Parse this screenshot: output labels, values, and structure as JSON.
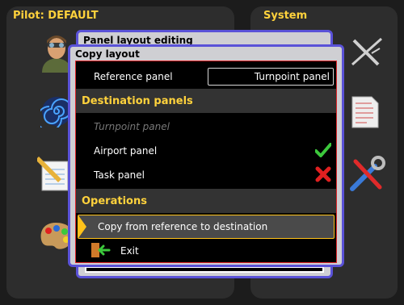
{
  "background": {
    "left_panel_title": "Pilot: DEFAULT",
    "right_panel_title": "System",
    "left_icons": [
      "pilot-avatar-icon",
      "spiral-icon",
      "notepad-icon",
      "palette-icon"
    ],
    "right_icons": [
      "airplane-icon",
      "document-list-icon",
      "tools-icon"
    ]
  },
  "back_dialog": {
    "title": "Panel layout editing"
  },
  "dialog": {
    "title": "Copy layout",
    "reference": {
      "label": "Reference panel",
      "value": "Turnpoint panel"
    },
    "destination_header": "Destination panels",
    "destinations": [
      {
        "label": "Turnpoint panel",
        "disabled": true,
        "status": ""
      },
      {
        "label": "Airport panel",
        "disabled": false,
        "status": "checkmark-icon"
      },
      {
        "label": "Task panel",
        "disabled": false,
        "status": "cross-icon"
      }
    ],
    "operations_header": "Operations",
    "operations": [
      {
        "label": "Copy from reference to destination",
        "selected": true
      },
      {
        "label": "Exit",
        "icon": "exit-door-icon"
      }
    ]
  },
  "colors": {
    "accent": "#ffd23c",
    "dialog_border": "#5a52d8",
    "content_border": "#e0262a",
    "selection_border": "#ffc21a",
    "check": "#3cc83c",
    "cross": "#e02020"
  }
}
